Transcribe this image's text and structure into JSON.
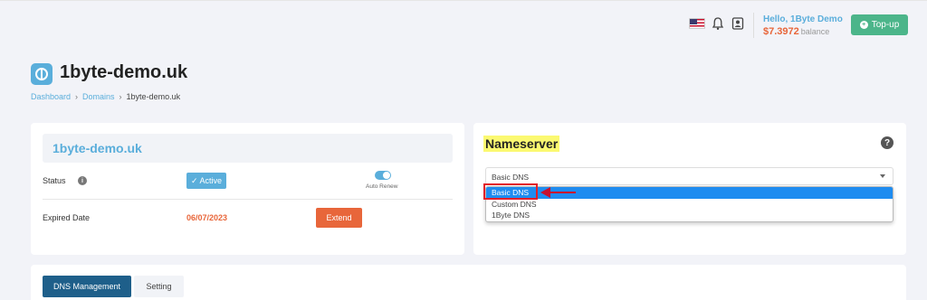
{
  "header": {
    "greeting": "Hello, 1Byte Demo",
    "balance": "$7.3972",
    "balance_label": "balance",
    "topup_label": "Top-up",
    "icons": [
      "us-flag-icon",
      "bell-icon",
      "contact-icon"
    ]
  },
  "page": {
    "title": "1byte-demo.uk",
    "breadcrumb": [
      "Dashboard",
      "Domains",
      "1byte-demo.uk"
    ]
  },
  "domain_card": {
    "name": "1byte-demo.uk",
    "status_label": "Status",
    "status_value": "✓ Active",
    "auto_renew_label": "Auto Renew",
    "auto_renew_on": true,
    "expired_label": "Expired Date",
    "expired_value": "06/07/2023",
    "extend_label": "Extend"
  },
  "nameserver": {
    "title": "Nameserver",
    "selected": "Basic DNS",
    "options": [
      "Basic DNS",
      "Custom DNS",
      "1Byte DNS"
    ]
  },
  "tabs": [
    {
      "label": "DNS Management",
      "active": true
    },
    {
      "label": "Setting",
      "active": false
    }
  ],
  "colors": {
    "accent": "#5aaedb",
    "orange": "#e8663a",
    "green": "#4cb58a",
    "tab_active": "#1e5f8a",
    "highlight": "#fbf971",
    "annotation_red": "#e21f2a"
  }
}
